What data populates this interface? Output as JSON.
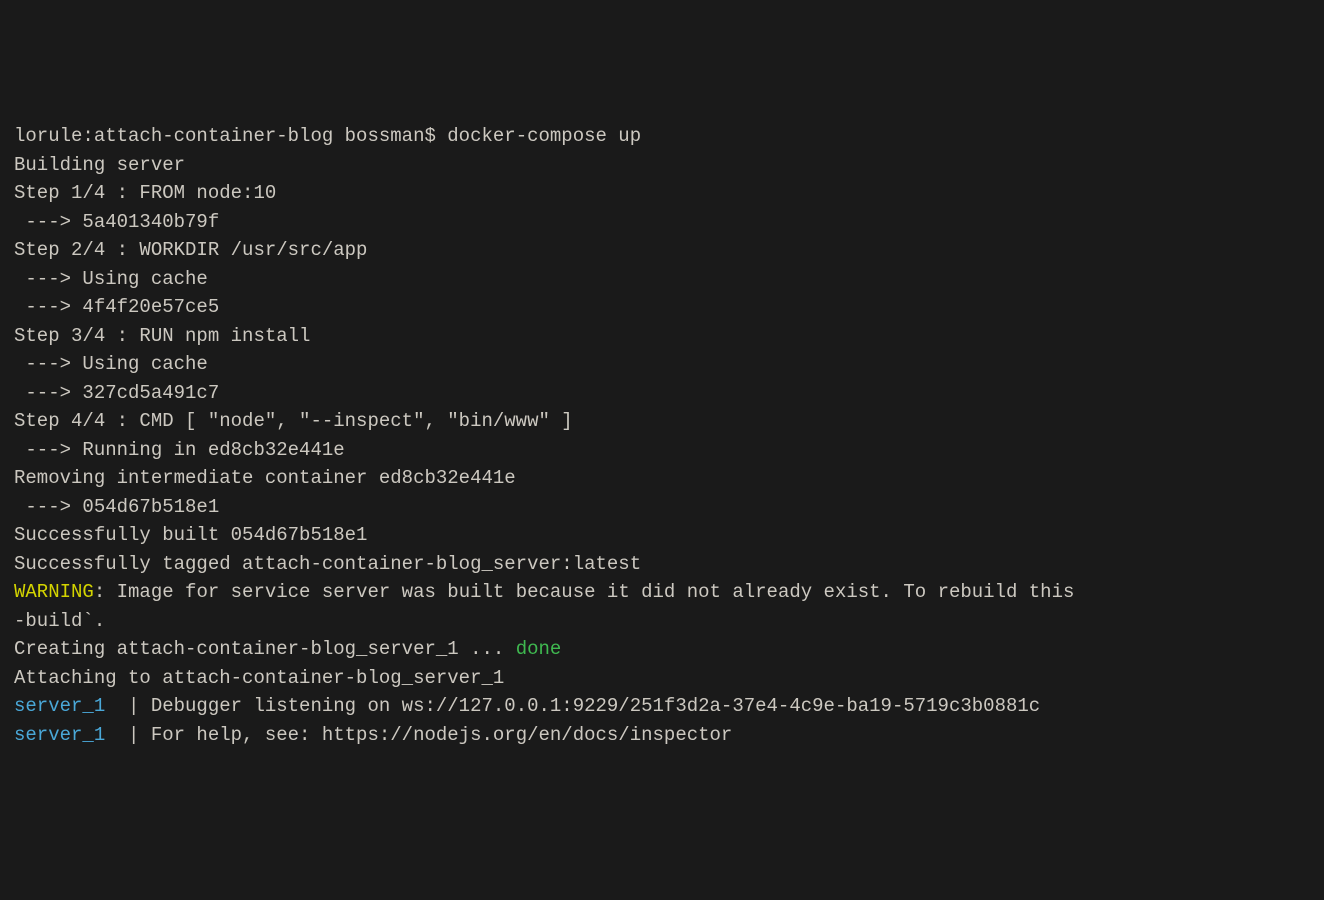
{
  "prompt": {
    "host_path": "lorule:attach-container-blog bossman$ ",
    "command": "docker-compose up"
  },
  "lines": {
    "building": "Building server",
    "step1": "Step 1/4 : FROM node:10",
    "step1_hash": " ---> 5a401340b79f",
    "step2": "Step 2/4 : WORKDIR /usr/src/app",
    "step2_cache": " ---> Using cache",
    "step2_hash": " ---> 4f4f20e57ce5",
    "step3": "Step 3/4 : RUN npm install",
    "step3_cache": " ---> Using cache",
    "step3_hash": " ---> 327cd5a491c7",
    "step4": "Step 4/4 : CMD [ \"node\", \"--inspect\", \"bin/www\" ]",
    "step4_running": " ---> Running in ed8cb32e441e",
    "removing": "Removing intermediate container ed8cb32e441e",
    "step4_hash": " ---> 054d67b518e1",
    "blank": "",
    "success_built": "Successfully built 054d67b518e1",
    "success_tagged": "Successfully tagged attach-container-blog_server:latest",
    "warning_label": "WARNING",
    "warning_rest": ": Image for service server was built because it did not already exist. To rebuild this ",
    "warning_line2": "-build`.",
    "creating_pre": "Creating attach-container-blog_server_1 ... ",
    "creating_done": "done",
    "attaching": "Attaching to attach-container-blog_server_1",
    "server_prefix": "server_1",
    "server_pipe": "  | ",
    "server1_msg": "Debugger listening on ws://127.0.0.1:9229/251f3d2a-37e4-4c9e-ba19-5719c3b0881c",
    "server2_msg": "For help, see: https://nodejs.org/en/docs/inspector"
  }
}
